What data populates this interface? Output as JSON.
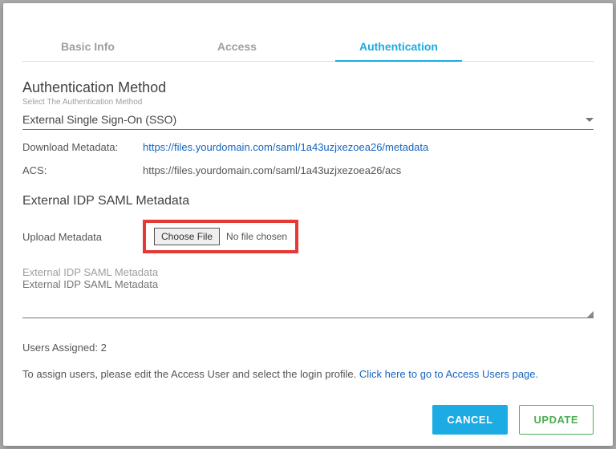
{
  "tabs": {
    "basic_info": "Basic Info",
    "access": "Access",
    "authentication": "Authentication"
  },
  "auth_method": {
    "title": "Authentication Method",
    "subtitle": "Select The Authentication Method",
    "value": "External Single Sign-On (SSO)"
  },
  "metadata": {
    "download_label": "Download Metadata:",
    "download_url": "https://files.yourdomain.com/saml/1a43uzjxezoea26/metadata",
    "acs_label": "ACS:",
    "acs_url": "https://files.yourdomain.com/saml/1a43uzjxezoea26/acs"
  },
  "idp": {
    "header": "External IDP SAML Metadata",
    "upload_label": "Upload Metadata",
    "choose_file": "Choose File",
    "no_file": "No file chosen",
    "textarea_placeholder": "External IDP SAML Metadata"
  },
  "users": {
    "assigned_label": "Users Assigned:",
    "assigned_count": "2",
    "note_prefix": "To assign users, please edit the Access User and select the login profile. ",
    "note_link": "Click here to go to Access Users page."
  },
  "footer": {
    "cancel": "CANCEL",
    "update": "UPDATE"
  }
}
